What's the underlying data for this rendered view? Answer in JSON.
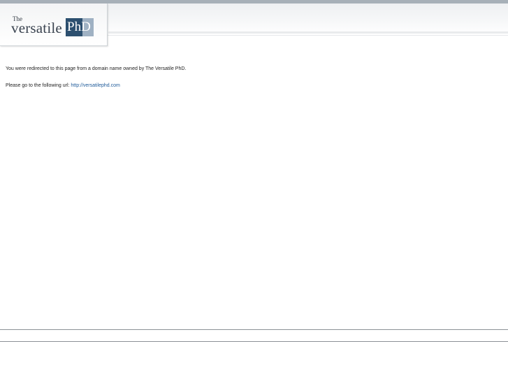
{
  "logo": {
    "the": "The",
    "versatile": "versatile",
    "phd": "PhD"
  },
  "message": {
    "redirect": "You were redirected to this page from a domain name owned by The Versatile PhD.",
    "prompt": "Please go to the following url:",
    "url": "http://versatilephd.com"
  },
  "colors": {
    "brand_dark": "#2c4f6f",
    "brand_light": "#9fb1c3",
    "link": "#1f5b9a"
  }
}
